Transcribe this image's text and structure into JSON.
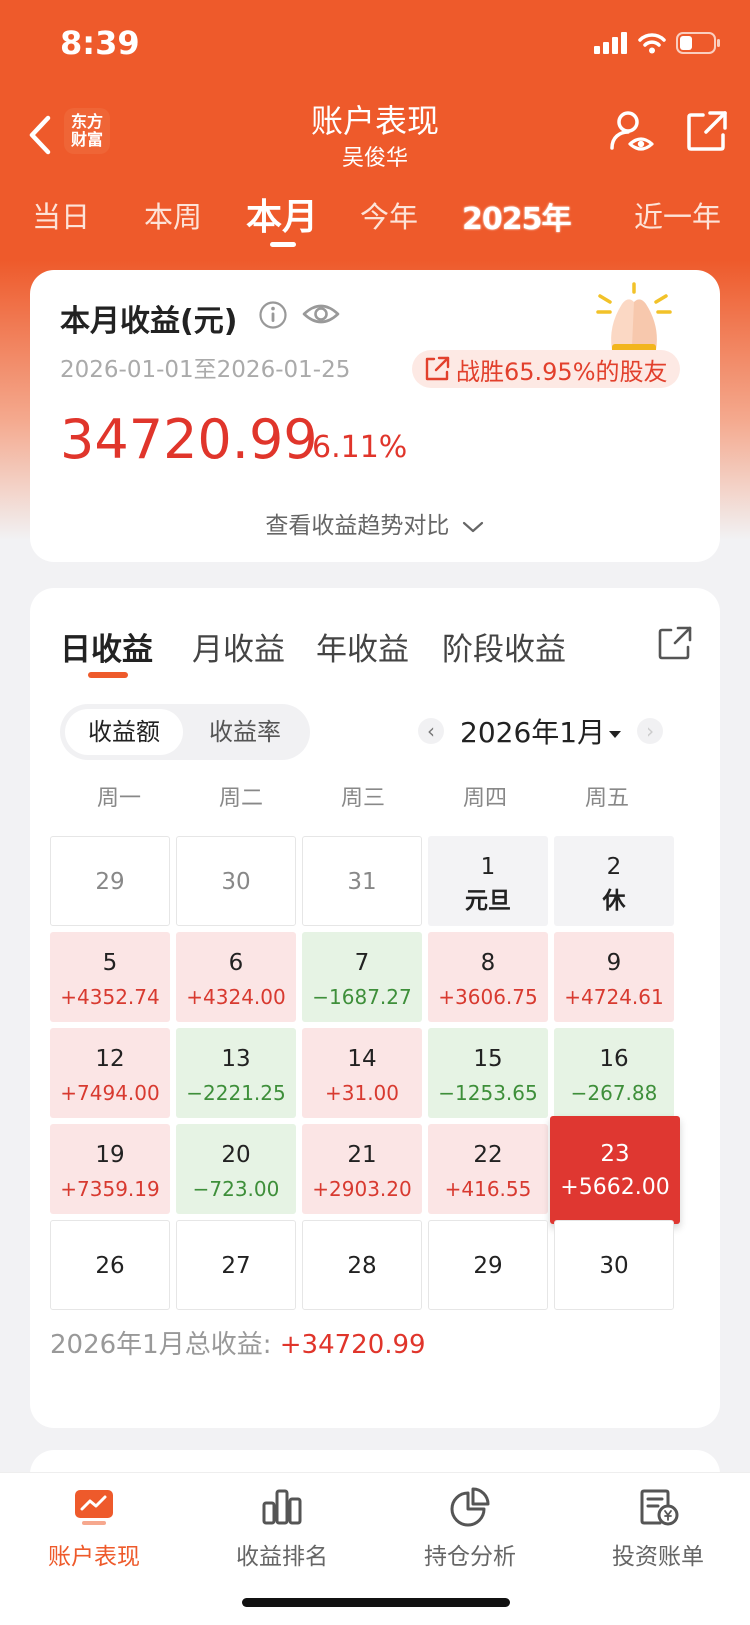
{
  "status_bar": {
    "time": "8:39"
  },
  "nav": {
    "logo_line1": "东方",
    "logo_line2": "财富",
    "title": "账户表现",
    "subtitle": "吴俊华"
  },
  "period_tabs": [
    "当日",
    "本周",
    "本月",
    "今年",
    "2025年",
    "近一年"
  ],
  "active_period_tab": "本月",
  "summary": {
    "heading": "本月收益(元)",
    "date_range": "2026-01-01至2026-01-25",
    "beat_text": "战胜65.95%的股友",
    "amount": "34720.99",
    "rate": "6.11%",
    "trend_link": "查看收益趋势对比"
  },
  "return_tabs": [
    "日收益",
    "月收益",
    "年收益",
    "阶段收益"
  ],
  "active_return_tab": "日收益",
  "segment": {
    "amount": "收益额",
    "rate": "收益率",
    "selected": "收益额"
  },
  "month_selector": {
    "label": "2026年1月"
  },
  "weekdays": [
    "周一",
    "周二",
    "周三",
    "周四",
    "周五"
  ],
  "calendar": [
    [
      {
        "day": "29",
        "value": "",
        "kind": "prev"
      },
      {
        "day": "30",
        "value": "",
        "kind": "prev"
      },
      {
        "day": "31",
        "value": "",
        "kind": "prev"
      },
      {
        "day": "1",
        "value": "元旦",
        "kind": "holiday"
      },
      {
        "day": "2",
        "value": "休",
        "kind": "holiday"
      }
    ],
    [
      {
        "day": "5",
        "value": "+4352.74",
        "kind": "pos"
      },
      {
        "day": "6",
        "value": "+4324.00",
        "kind": "pos"
      },
      {
        "day": "7",
        "value": "−1687.27",
        "kind": "neg"
      },
      {
        "day": "8",
        "value": "+3606.75",
        "kind": "pos"
      },
      {
        "day": "9",
        "value": "+4724.61",
        "kind": "pos"
      }
    ],
    [
      {
        "day": "12",
        "value": "+7494.00",
        "kind": "pos"
      },
      {
        "day": "13",
        "value": "−2221.25",
        "kind": "neg"
      },
      {
        "day": "14",
        "value": "+31.00",
        "kind": "pos"
      },
      {
        "day": "15",
        "value": "−1253.65",
        "kind": "neg"
      },
      {
        "day": "16",
        "value": "−267.88",
        "kind": "neg"
      }
    ],
    [
      {
        "day": "19",
        "value": "+7359.19",
        "kind": "pos"
      },
      {
        "day": "20",
        "value": "−723.00",
        "kind": "neg"
      },
      {
        "day": "21",
        "value": "+2903.20",
        "kind": "pos"
      },
      {
        "day": "22",
        "value": "+416.55",
        "kind": "pos"
      },
      {
        "day": "23",
        "value": "+5662.00",
        "kind": "selected"
      }
    ],
    [
      {
        "day": "26",
        "value": "",
        "kind": "future"
      },
      {
        "day": "27",
        "value": "",
        "kind": "future"
      },
      {
        "day": "28",
        "value": "",
        "kind": "future"
      },
      {
        "day": "29",
        "value": "",
        "kind": "future"
      },
      {
        "day": "30",
        "value": "",
        "kind": "future"
      }
    ]
  ],
  "total": {
    "label": "2026年1月总收益: ",
    "value": "+34720.99"
  },
  "tabbar": [
    "账户表现",
    "收益排名",
    "持仓分析",
    "投资账单"
  ],
  "active_tabbar": "账户表现",
  "colors": {
    "brand": "#ee5a2b",
    "up": "#e0352b",
    "down": "#3e8f3a"
  }
}
